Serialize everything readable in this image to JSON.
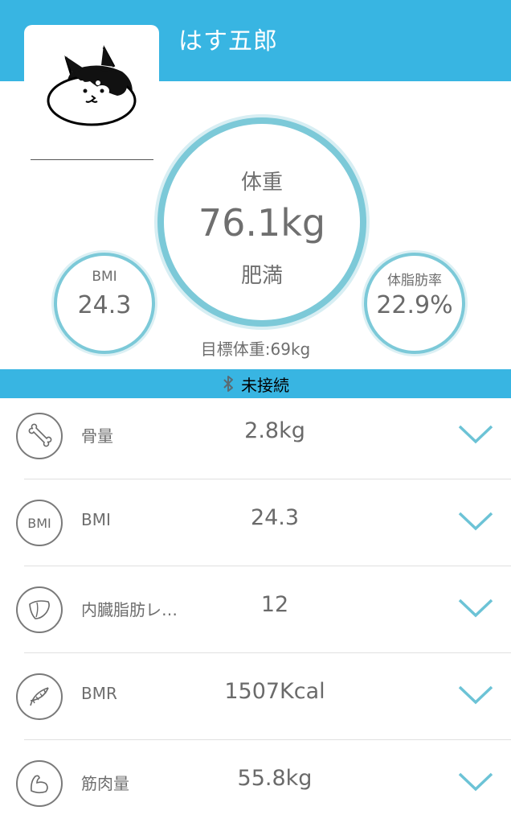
{
  "header": {
    "user_name": "はす五郎"
  },
  "summary": {
    "weight_label": "体重",
    "weight_value": "76.1kg",
    "weight_status": "肥満",
    "bmi_label": "BMI",
    "bmi_value": "24.3",
    "fat_label": "体脂肪率",
    "fat_value": "22.9%",
    "target": "目標体重:69kg"
  },
  "bluetooth": {
    "icon": "bluetooth-icon",
    "status": "未接続"
  },
  "metrics": [
    {
      "icon": "bone-icon",
      "name": "骨量",
      "value": "2.8kg"
    },
    {
      "icon": "bmi-icon",
      "icon_text": "BMI",
      "name": "BMI",
      "value": "24.3"
    },
    {
      "icon": "liver-icon",
      "name": "内臓脂肪レ…",
      "value": "12"
    },
    {
      "icon": "dna-icon",
      "name": "BMR",
      "value": "1507Kcal"
    },
    {
      "icon": "muscle-icon",
      "name": "筋肉量",
      "value": "55.8kg"
    }
  ],
  "colors": {
    "header": "#38b5e2",
    "ring": "#7cc9d8",
    "chevron": "#6cc3d6"
  }
}
